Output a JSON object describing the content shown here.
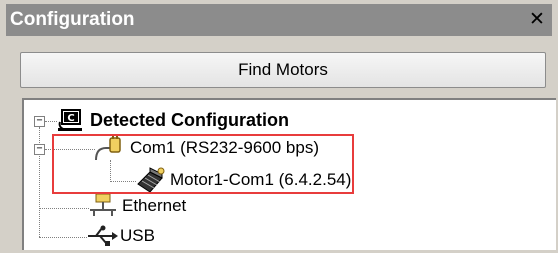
{
  "panel": {
    "title": "Configuration",
    "close_glyph": "✕"
  },
  "toolbar": {
    "find_motors_label": "Find Motors"
  },
  "tree": {
    "root": {
      "label": "Detected Configuration",
      "icon": "config-c-icon",
      "expander": "−"
    },
    "com1": {
      "label": "Com1 (RS232-9600 bps)",
      "icon": "serial-port-icon",
      "expander": "−"
    },
    "motor1": {
      "label": "Motor1-Com1 (6.4.2.54)",
      "icon": "motor-icon"
    },
    "ethernet": {
      "label": "Ethernet",
      "icon": "ethernet-icon"
    },
    "usb": {
      "label": "USB",
      "icon": "usb-icon"
    }
  },
  "colors": {
    "titlebar_bg": "#8c8c8c",
    "highlight": "#e83c3c",
    "panel_bg": "#d4d0c8"
  }
}
